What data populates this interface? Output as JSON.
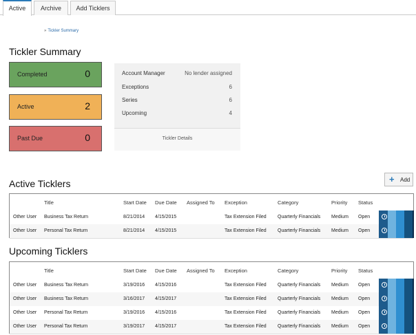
{
  "tabs": [
    "Active",
    "Archive",
    "Add Ticklers"
  ],
  "breadcrumb": {
    "sep": "»",
    "label": "Tickler Summary"
  },
  "summary": {
    "title": "Tickler Summary",
    "cards": [
      {
        "label": "Completed",
        "value": "0",
        "color": "#6aa35e"
      },
      {
        "label": "Active",
        "value": "2",
        "color": "#f0b157"
      },
      {
        "label": "Past Due",
        "value": "0",
        "color": "#d8706e"
      }
    ],
    "details": {
      "rows": [
        {
          "label": "Account Manager",
          "value": "No lender assigned"
        },
        {
          "label": "Exceptions",
          "value": "6"
        },
        {
          "label": "Series",
          "value": "6"
        },
        {
          "label": "Upcoming",
          "value": "4"
        }
      ],
      "footer": "Tickler Details"
    }
  },
  "active": {
    "title": "Active Ticklers",
    "add_label": "Add",
    "headers": [
      "Title",
      "Start Date",
      "Due Date",
      "Assigned To",
      "Exception",
      "Category",
      "Priority",
      "Status"
    ],
    "rows": [
      [
        "Other User",
        "Business Tax Return",
        "8/21/2014",
        "4/15/2015",
        "",
        "Tax Extension Filed",
        "Quarterly Financials",
        "Medium",
        "Open"
      ],
      [
        "Other User",
        "Personal Tax Return",
        "8/21/2014",
        "4/15/2015",
        "",
        "Tax Extension Filed",
        "Quarterly Financials",
        "Medium",
        "Open"
      ]
    ]
  },
  "upcoming": {
    "title": "Upcoming Ticklers",
    "headers": [
      "Title",
      "Start Date",
      "Due Date",
      "Assigned To",
      "Exception",
      "Category",
      "Priority",
      "Status"
    ],
    "rows": [
      [
        "Other User",
        "Business Tax Return",
        "3/19/2016",
        "4/15/2016",
        "",
        "Tax Extension Filed",
        "Quarterly Financials",
        "Medium",
        "Open"
      ],
      [
        "Other User",
        "Business Tax Return",
        "3/16/2017",
        "4/15/2017",
        "",
        "Tax Extension Filed",
        "Quarterly Financials",
        "Medium",
        "Open"
      ],
      [
        "Other User",
        "Personal Tax Return",
        "3/19/2016",
        "4/15/2016",
        "",
        "Tax Extension Filed",
        "Quarterly Financials",
        "Medium",
        "Open"
      ],
      [
        "Other User",
        "Personal Tax Return",
        "3/19/2017",
        "4/15/2017",
        "",
        "Tax Extension Filed",
        "Quarterly Financials",
        "Medium",
        "Open"
      ]
    ]
  },
  "action_colors": [
    "#1e5b8c",
    "#6fb3df",
    "#2f8fd0",
    "#15527e",
    "#0a2a4a"
  ],
  "icons": {
    "add": "plus-icon",
    "row_action": "history-icon"
  }
}
